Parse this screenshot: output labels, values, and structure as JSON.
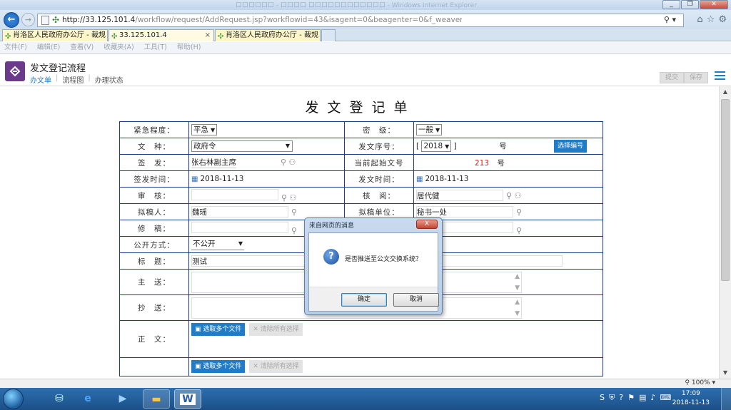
{
  "browser": {
    "window_title": "口口口口口口 - 口口口口 口口口口口口口口口口口口 - Windows Internet Explorer",
    "url_host": "http://33.125.101.4",
    "url_path": "/workflow/request/AddRequest.jsp?workflowid=43&isagent=0&beagenter=0&f_weaver_belongto_userid=",
    "tabs": [
      {
        "label": "肖洛区人民政府办公厅 - 裁规"
      },
      {
        "label": "33.125.101.4"
      },
      {
        "label": "肖洛区人民政府办公厅 - 裁规"
      }
    ],
    "menu": [
      "文件(F)",
      "编辑(E)",
      "查看(V)",
      "收藏夹(A)",
      "工具(T)",
      "帮助(H)"
    ],
    "zoom": "100%"
  },
  "app": {
    "title": "发文登记流程",
    "subnav": [
      "办文单",
      "流程图",
      "办理状态"
    ],
    "actions": [
      "提交",
      "保存"
    ]
  },
  "form": {
    "title": "发文登记单",
    "urgency_label": "紧急程度：",
    "urgency_value": "平急",
    "secret_label": "密　级：",
    "secret_value": "一般",
    "doctype_label": "文　种：",
    "doctype_value": "政府令",
    "serial_label": "发文序号：",
    "serial_year": "2018",
    "serial_suffix": "号",
    "choose_number_btn": "选择编号",
    "signer_label": "签　发：",
    "signer_value": "张右林副主席",
    "start_no_label": "当前起始文号",
    "start_no_value": "213",
    "start_no_suffix": "号",
    "sign_time_label": "签发时间：",
    "sign_time_value": "2018-11-13",
    "send_time_label": "发文时间：",
    "send_time_value": "2018-11-13",
    "review_label": "审　核：",
    "proof_label": "核　阅：",
    "proof_value": "居代健",
    "drafter_label": "拟稿人：",
    "drafter_value": "魏瑶",
    "draft_unit_label": "拟稿单位：",
    "draft_unit_value": "秘书一处",
    "editor_label": "修　稿：",
    "public_label": "公开方式：",
    "public_value": "不公开",
    "subject_label": "标　题：",
    "subject_value": "测试",
    "main_send_label": "主　送：",
    "cc_label": "抄　送：",
    "body_label": "正　文：",
    "select_files_btn": "选取多个文件",
    "clear_btn": "清除所有选择"
  },
  "dialog": {
    "title": "来自网页的消息",
    "close_label": "X",
    "message": "是否推送至公文交换系统？",
    "ok_label": "确定",
    "cancel_label": "取消"
  },
  "taskbar": {
    "time": "17:09",
    "date": "2018-11-13"
  }
}
